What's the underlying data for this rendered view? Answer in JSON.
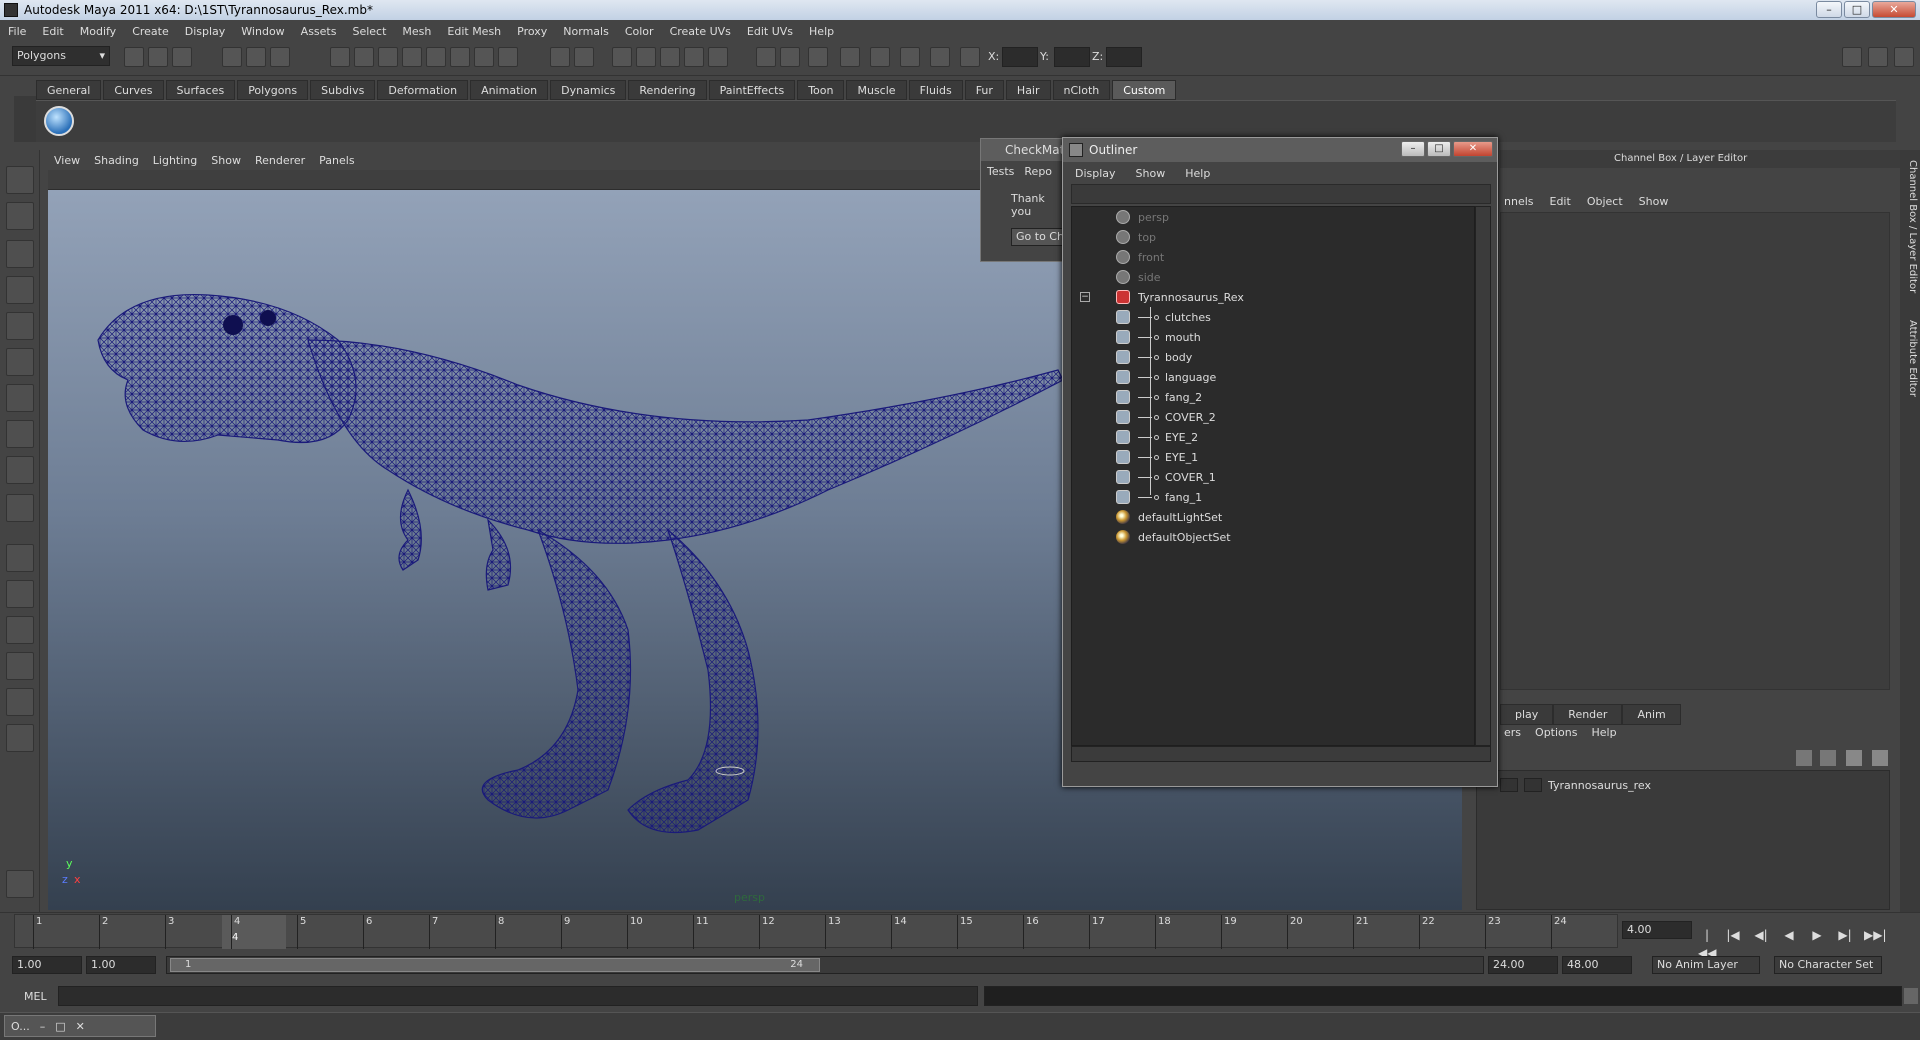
{
  "window": {
    "title": "Autodesk Maya 2011 x64: D:\\1ST\\Tyrannosaurus_Rex.mb*",
    "minimize": "–",
    "maximize": "□",
    "close": "✕"
  },
  "menubar": [
    "File",
    "Edit",
    "Modify",
    "Create",
    "Display",
    "Window",
    "Assets",
    "Select",
    "Mesh",
    "Edit Mesh",
    "Proxy",
    "Normals",
    "Color",
    "Create UVs",
    "Edit UVs",
    "Help"
  ],
  "toolbar": {
    "mode_select": "Polygons",
    "x_label": "X:",
    "y_label": "Y:",
    "z_label": "Z:"
  },
  "shelf_tabs": [
    "General",
    "Curves",
    "Surfaces",
    "Polygons",
    "Subdivs",
    "Deformation",
    "Animation",
    "Dynamics",
    "Rendering",
    "PaintEffects",
    "Toon",
    "Muscle",
    "Fluids",
    "Fur",
    "Hair",
    "nCloth",
    "Custom"
  ],
  "shelf_active": "Custom",
  "viewport": {
    "menu": [
      "View",
      "Shading",
      "Lighting",
      "Show",
      "Renderer",
      "Panels"
    ],
    "camera_label": "persp",
    "axis_x": "x",
    "axis_y": "y",
    "axis_z": "z"
  },
  "checkmate": {
    "title": "CheckMat",
    "menu": [
      "Tests",
      "Repo"
    ],
    "text": "Thank you",
    "button": "Go to Ch"
  },
  "outliner": {
    "title": "Outliner",
    "menu": [
      "Display",
      "Show",
      "Help"
    ],
    "items": [
      {
        "label": "persp",
        "type": "camera",
        "dim": true
      },
      {
        "label": "top",
        "type": "camera",
        "dim": true
      },
      {
        "label": "front",
        "type": "camera",
        "dim": true
      },
      {
        "label": "side",
        "type": "camera",
        "dim": true
      },
      {
        "label": "Tyrannosaurus_Rex",
        "type": "group",
        "dim": false
      },
      {
        "label": "clutches",
        "type": "mesh",
        "dim": false
      },
      {
        "label": "mouth",
        "type": "mesh",
        "dim": false
      },
      {
        "label": "body",
        "type": "mesh",
        "dim": false
      },
      {
        "label": "language",
        "type": "mesh",
        "dim": false
      },
      {
        "label": "fang_2",
        "type": "mesh",
        "dim": false
      },
      {
        "label": "COVER_2",
        "type": "mesh",
        "dim": false
      },
      {
        "label": "EYE_2",
        "type": "mesh",
        "dim": false
      },
      {
        "label": "EYE_1",
        "type": "mesh",
        "dim": false
      },
      {
        "label": "COVER_1",
        "type": "mesh",
        "dim": false
      },
      {
        "label": "fang_1",
        "type": "mesh",
        "dim": false
      },
      {
        "label": "defaultLightSet",
        "type": "set",
        "dim": false
      },
      {
        "label": "defaultObjectSet",
        "type": "set",
        "dim": false
      }
    ],
    "collapse_symbol": "−"
  },
  "channel_box": {
    "title": "Channel Box / Layer Editor",
    "menu": [
      "nnels",
      "Edit",
      "Object",
      "Show"
    ],
    "layer_tabs": [
      "play",
      "Render",
      "Anim"
    ],
    "layer_menu": [
      "ers",
      "Options",
      "Help"
    ],
    "layer_name": "Tyrannosaurus_rex",
    "vtab_channel": "Channel Box / Layer Editor",
    "vtab_attr": "Attribute Editor"
  },
  "timeline": {
    "ticks": [
      "1",
      "2",
      "3",
      "4",
      "5",
      "6",
      "7",
      "8",
      "9",
      "10",
      "11",
      "12",
      "13",
      "14",
      "15",
      "16",
      "17",
      "18",
      "19",
      "20",
      "21",
      "22",
      "23",
      "24"
    ],
    "current_frame_marker": "4",
    "current_time": "4.00",
    "start_time": "1.00",
    "playback_start": "1.00",
    "range_start_label": "1",
    "range_end_label": "24",
    "playback_end": "24.00",
    "end_time": "48.00",
    "anim_layer": "No Anim Layer",
    "character_set": "No Character Set",
    "playback_buttons": [
      "|◀◀",
      "|◀",
      "◀|",
      "◀",
      "▶",
      "▶|",
      "▶▶|"
    ]
  },
  "mel": {
    "label": "MEL"
  },
  "taskbar": {
    "item_label": "O..."
  },
  "colors": {
    "wireframe": "#1a1a7a",
    "bg_dark": "#444444"
  }
}
